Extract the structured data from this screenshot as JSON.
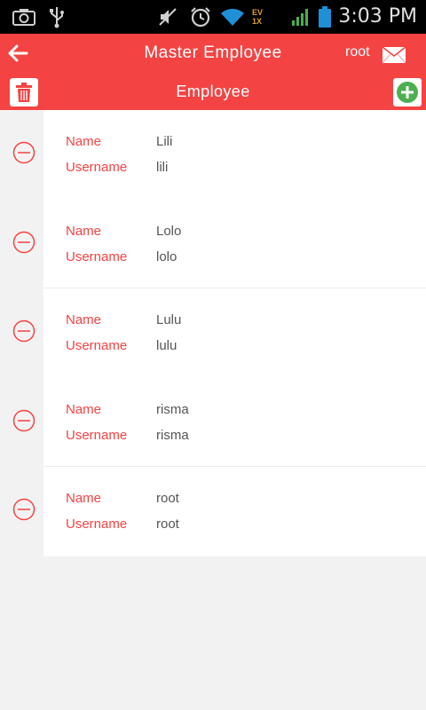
{
  "status_bar": {
    "time": "3:03 PM",
    "icons": [
      "camera-icon",
      "usb-icon",
      "mute-icon",
      "alarm-icon",
      "wifi-icon",
      "evdo-signal-icon",
      "cell-signal-icon",
      "battery-icon"
    ],
    "network_label_top": "EV",
    "network_label_bottom": "1X"
  },
  "appbar": {
    "title": "Master Employee",
    "user": "root",
    "icons": {
      "back": "arrow-left-icon",
      "mail": "envelope-icon"
    }
  },
  "subbar": {
    "title": "Employee",
    "icons": {
      "delete": "trash-icon",
      "add": "plus-circle-icon"
    },
    "colors": {
      "delete": "#f44343",
      "add": "#4caf50"
    }
  },
  "list": {
    "name_label": "Name",
    "username_label": "Username",
    "items": [
      {
        "name": "Lili",
        "username": "lili"
      },
      {
        "name": "Lolo",
        "username": "lolo"
      },
      {
        "name": "Lulu",
        "username": "lulu"
      },
      {
        "name": "risma",
        "username": "risma"
      },
      {
        "name": "root",
        "username": "root"
      }
    ]
  },
  "colors": {
    "accent": "#f44343",
    "background": "#f2f2f2",
    "card": "#ffffff",
    "value_text": "#555555"
  }
}
